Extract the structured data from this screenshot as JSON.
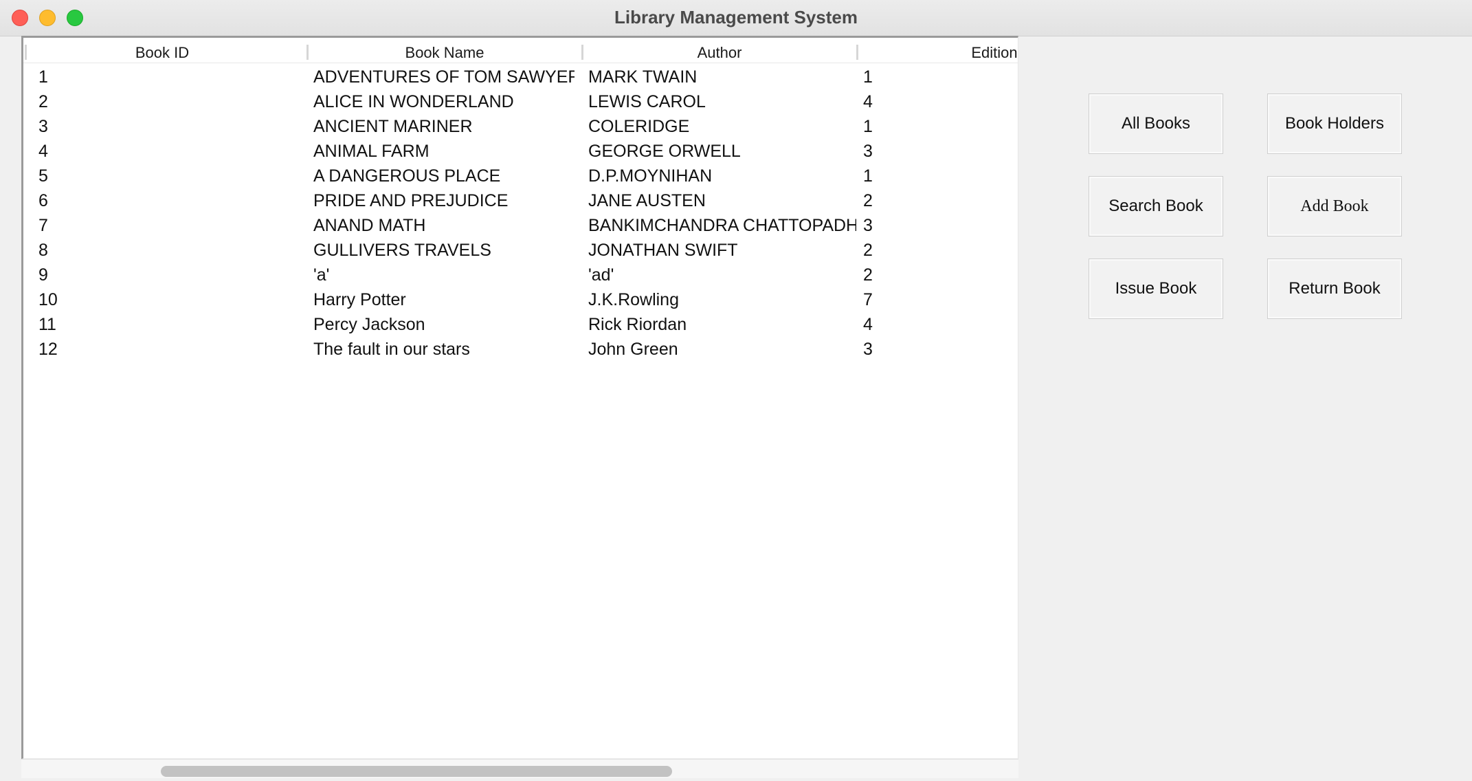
{
  "window": {
    "title": "Library Management System"
  },
  "table": {
    "columns": [
      "Book ID",
      "Book Name",
      "Author",
      "Edition"
    ],
    "rows": [
      [
        "1",
        "ADVENTURES OF TOM SAWYER",
        "MARK TWAIN",
        "1"
      ],
      [
        "2",
        "ALICE IN WONDERLAND",
        "LEWIS CAROL",
        "4"
      ],
      [
        "3",
        "ANCIENT MARINER",
        "COLERIDGE",
        "1"
      ],
      [
        "4",
        "ANIMAL FARM",
        "GEORGE ORWELL",
        "3"
      ],
      [
        "5",
        "A DANGEROUS PLACE",
        "D.P.MOYNIHAN",
        "1"
      ],
      [
        "6",
        "PRIDE AND PREJUDICE",
        "JANE AUSTEN",
        "2"
      ],
      [
        "7",
        "ANAND MATH",
        "BANKIMCHANDRA CHATTOPADHYAY",
        "3"
      ],
      [
        "8",
        "GULLIVERS TRAVELS",
        "JONATHAN SWIFT",
        "2"
      ],
      [
        "9",
        "'a'",
        "'ad'",
        "2"
      ],
      [
        "10",
        "Harry Potter",
        "J.K.Rowling",
        "7"
      ],
      [
        "11",
        "Percy Jackson",
        "Rick Riordan",
        "4"
      ],
      [
        "12",
        "The fault in our stars",
        "John Green",
        "3"
      ]
    ]
  },
  "buttons": {
    "all_books": "All Books",
    "book_holders": "Book Holders",
    "search_book": "Search Book",
    "add_book": "Add Book",
    "issue_book": "Issue Book",
    "return_book": "Return Book"
  }
}
